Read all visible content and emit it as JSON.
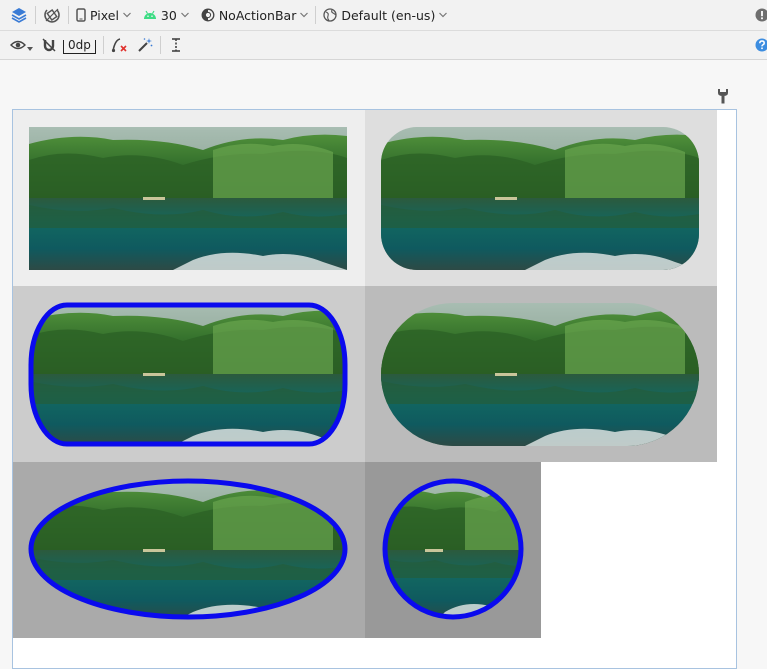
{
  "toolbar": {
    "device": "Pixel",
    "api_level": "30",
    "theme": "NoActionBar",
    "locale": "Default (en-us)",
    "default_margin": "0dp"
  },
  "icons": {
    "design_surface": "layers-icon",
    "orientation": "rotate-icon",
    "device": "phone-icon",
    "api": "android-icon",
    "theme": "theme-icon",
    "locale": "globe-icon",
    "view_options": "eye-icon",
    "autoconnect": "magnet-off-icon",
    "clear_constraints": "clear-constraints-icon",
    "infer_constraints": "magic-wand-icon",
    "guidelines": "guideline-icon",
    "warning": "warning-icon",
    "help": "help-icon",
    "attributes": "wrench-icon"
  },
  "colors": {
    "accent_stroke": "#0a0aee",
    "cell_bg_1": "#eeeeee",
    "cell_bg_2": "#dedede",
    "cell_bg_3": "#cccccc",
    "cell_bg_4": "#bbbbbb",
    "cell_bg_5": "#aaaaaa",
    "cell_bg_6": "#999999"
  },
  "image_cells": [
    {
      "name": "image-rect"
    },
    {
      "name": "image-rounded"
    },
    {
      "name": "image-rounded-stroked"
    },
    {
      "name": "image-pill"
    },
    {
      "name": "image-oval-stroked"
    },
    {
      "name": "image-circle-stroked"
    }
  ]
}
